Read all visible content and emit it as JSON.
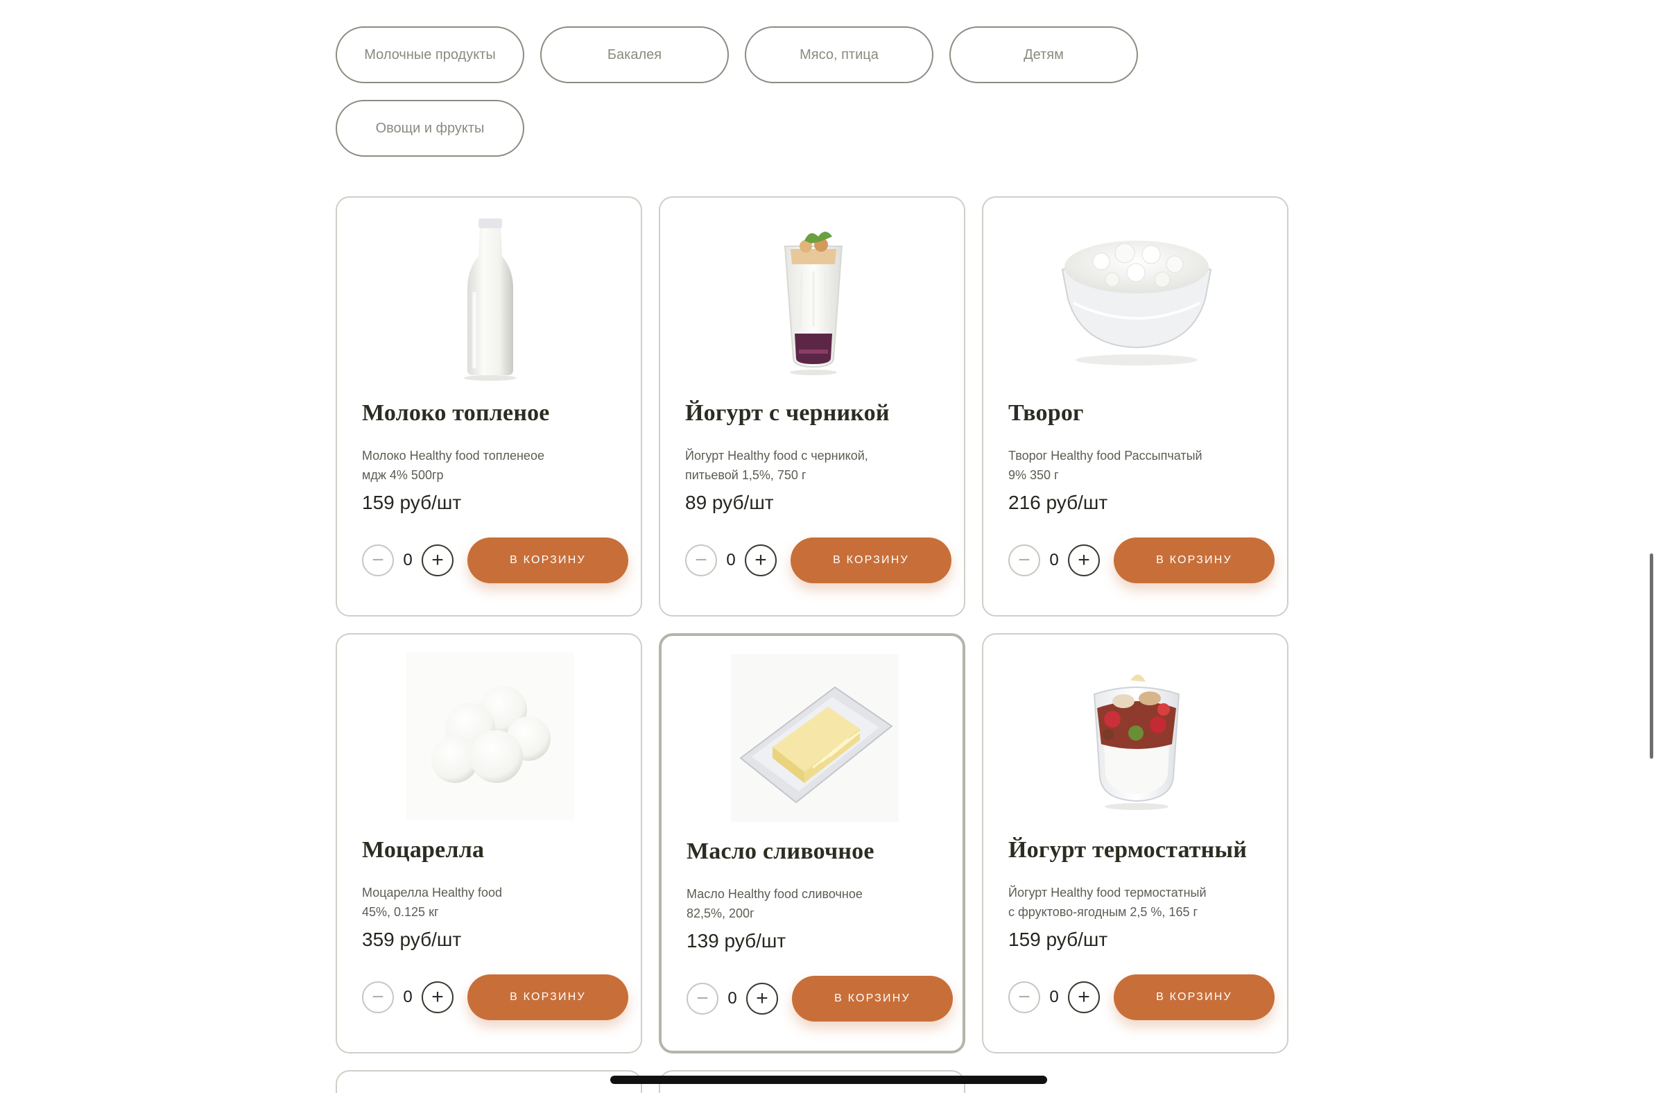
{
  "categories": [
    "Молочные продукты",
    "Бакалея",
    "Мясо, птица",
    "Детям",
    "Овощи и фрукты"
  ],
  "colors": {
    "accent": "#c86f39",
    "chip_border": "#8c8c82",
    "card_border": "#cfcfc8",
    "active_card_border": "#b4b5a8"
  },
  "cart_label": "В КОРЗИНУ",
  "products": [
    {
      "title": "Молоко топленое",
      "desc_lines": [
        "Молоко Healthy food топленеое",
        "мдж 4% 500гр"
      ],
      "price": "159 руб/шт",
      "qty": "0",
      "icon": "milk-bottle-image"
    },
    {
      "title": "Йогурт с черникой",
      "desc_lines": [
        "Йогурт Healthy food с черникой,",
        "питьевой 1,5%, 750 г"
      ],
      "price": "89 руб/шт",
      "qty": "0",
      "icon": "blueberry-yogurt-image"
    },
    {
      "title": "Творог",
      "desc_lines": [
        "Творог Healthy food Рассыпчатый",
        "9% 350 г"
      ],
      "price": "216 руб/шт",
      "qty": "0",
      "icon": "cottage-cheese-image"
    },
    {
      "title": "Моцарелла",
      "desc_lines": [
        "Моцарелла Healthy food",
        "45%, 0.125 кг"
      ],
      "price": "359 руб/шт",
      "qty": "0",
      "icon": "mozzarella-image"
    },
    {
      "title": "Масло сливочное",
      "desc_lines": [
        "Масло Healthy food сливочное",
        "82,5%, 200г"
      ],
      "price": "139 руб/шт",
      "qty": "0",
      "icon": "butter-image"
    },
    {
      "title": "Йогурт термостатный",
      "desc_lines": [
        "Йогурт Healthy food термостатный",
        "с фруктово-ягодным 2,5 %, 165 г"
      ],
      "price": "159 руб/шт",
      "qty": "0",
      "icon": "fruit-yogurt-image"
    }
  ]
}
